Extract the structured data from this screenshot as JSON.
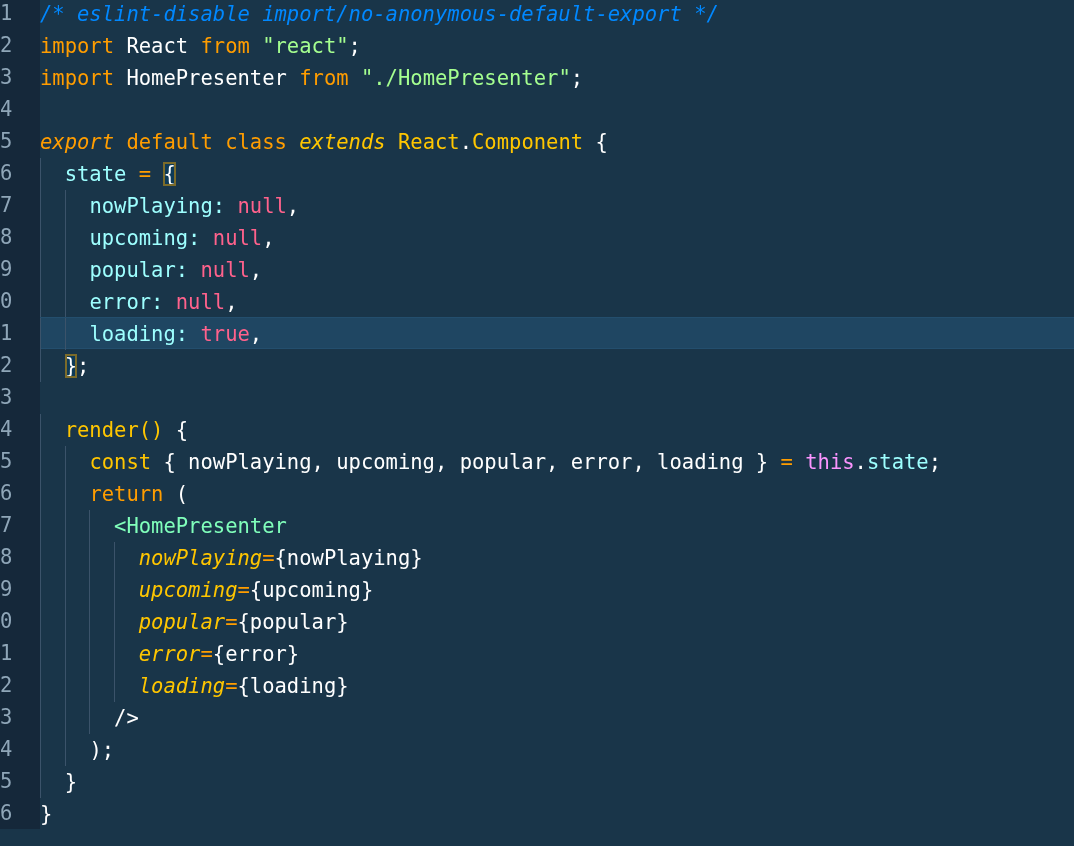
{
  "editor": {
    "lines": [
      {
        "number": "1",
        "highlighted": false,
        "tokens": [
          {
            "kind": "comment",
            "text": "/* eslint-disable import/no-anonymous-default-export */"
          }
        ]
      },
      {
        "number": "2",
        "highlighted": false,
        "tokens": [
          {
            "kind": "keyword",
            "text": "import"
          },
          {
            "kind": "plain",
            "text": " React "
          },
          {
            "kind": "keyword",
            "text": "from "
          },
          {
            "kind": "string",
            "text": "\"react\""
          },
          {
            "kind": "plain",
            "text": ";"
          }
        ]
      },
      {
        "number": "3",
        "highlighted": false,
        "tokens": [
          {
            "kind": "keyword",
            "text": "import"
          },
          {
            "kind": "plain",
            "text": " HomePresenter "
          },
          {
            "kind": "keyword",
            "text": "from "
          },
          {
            "kind": "string",
            "text": "\"./HomePresenter\""
          },
          {
            "kind": "plain",
            "text": ";"
          }
        ]
      },
      {
        "number": "4",
        "highlighted": false
      },
      {
        "number": "5",
        "highlighted": false,
        "tokens": [
          {
            "kind": "modifier",
            "text": "export "
          },
          {
            "kind": "keyword",
            "text": "default class "
          },
          {
            "kind": "extends",
            "text": "extends "
          },
          {
            "kind": "class",
            "text": "React"
          },
          {
            "kind": "plain",
            "text": "."
          },
          {
            "kind": "class",
            "text": "Component"
          },
          {
            "kind": "plain",
            "text": " {"
          }
        ]
      },
      {
        "number": "6",
        "highlighted": false,
        "tokens": [
          {
            "kind": "property",
            "text": "  state "
          },
          {
            "kind": "operator",
            "text": "= "
          },
          {
            "kind": "match",
            "text": "{"
          }
        ]
      },
      {
        "number": "7",
        "highlighted": false,
        "tokens": [
          {
            "kind": "property",
            "text": "    nowPlaying: "
          },
          {
            "kind": "constant",
            "text": "null"
          },
          {
            "kind": "plain",
            "text": ","
          }
        ]
      },
      {
        "number": "8",
        "highlighted": false,
        "tokens": [
          {
            "kind": "property",
            "text": "    upcoming: "
          },
          {
            "kind": "constant",
            "text": "null"
          },
          {
            "kind": "plain",
            "text": ","
          }
        ]
      },
      {
        "number": "9",
        "highlighted": false,
        "tokens": [
          {
            "kind": "property",
            "text": "    popular: "
          },
          {
            "kind": "constant",
            "text": "null"
          },
          {
            "kind": "plain",
            "text": ","
          }
        ]
      },
      {
        "number": "0",
        "highlighted": false,
        "tokens": [
          {
            "kind": "property",
            "text": "    error: "
          },
          {
            "kind": "constant",
            "text": "null"
          },
          {
            "kind": "plain",
            "text": ","
          }
        ]
      },
      {
        "number": "1",
        "highlighted": true,
        "tokens": [
          {
            "kind": "property",
            "text": "    loading: "
          },
          {
            "kind": "constant",
            "text": "true"
          },
          {
            "kind": "plain",
            "text": ","
          }
        ]
      },
      {
        "number": "2",
        "highlighted": false,
        "tokens": [
          {
            "kind": "match",
            "text": "  }"
          },
          {
            "kind": "plain",
            "text": ";"
          }
        ]
      },
      {
        "number": "3",
        "highlighted": false
      },
      {
        "number": "4",
        "highlighted": false,
        "tokens": [
          {
            "kind": "function",
            "text": "  render()"
          },
          {
            "kind": "plain",
            "text": " {"
          }
        ]
      },
      {
        "number": "5",
        "highlighted": false,
        "tokens": [
          {
            "kind": "storage",
            "text": "    const"
          },
          {
            "kind": "plain",
            "text": " { nowPlaying, upcoming, popular, error, loading } "
          },
          {
            "kind": "operator",
            "text": "= "
          },
          {
            "kind": "this",
            "text": "this"
          },
          {
            "kind": "plain",
            "text": "."
          },
          {
            "kind": "property",
            "text": "state"
          },
          {
            "kind": "plain",
            "text": ";"
          }
        ]
      },
      {
        "number": "6",
        "highlighted": false,
        "tokens": [
          {
            "kind": "keyword",
            "text": "    return"
          },
          {
            "kind": "plain",
            "text": " ("
          }
        ]
      },
      {
        "number": "7",
        "highlighted": false,
        "tokens": [
          {
            "kind": "tag",
            "text": "      <HomePresenter"
          }
        ]
      },
      {
        "number": "8",
        "highlighted": false,
        "tokens": [
          {
            "kind": "attribute",
            "text": "        nowPlaying"
          },
          {
            "kind": "operator",
            "text": "="
          },
          {
            "kind": "plain",
            "text": "{nowPlaying}"
          }
        ]
      },
      {
        "number": "9",
        "highlighted": false,
        "tokens": [
          {
            "kind": "attribute",
            "text": "        upcoming"
          },
          {
            "kind": "operator",
            "text": "="
          },
          {
            "kind": "plain",
            "text": "{upcoming}"
          }
        ]
      },
      {
        "number": "0",
        "highlighted": false,
        "tokens": [
          {
            "kind": "attribute",
            "text": "        popular"
          },
          {
            "kind": "operator",
            "text": "="
          },
          {
            "kind": "plain",
            "text": "{popular}"
          }
        ]
      },
      {
        "number": "1",
        "highlighted": false,
        "tokens": [
          {
            "kind": "attribute",
            "text": "        error"
          },
          {
            "kind": "operator",
            "text": "="
          },
          {
            "kind": "plain",
            "text": "{error}"
          }
        ]
      },
      {
        "number": "2",
        "highlighted": false,
        "tokens": [
          {
            "kind": "attribute",
            "text": "        loading"
          },
          {
            "kind": "operator",
            "text": "="
          },
          {
            "kind": "plain",
            "text": "{loading}"
          }
        ]
      },
      {
        "number": "3",
        "highlighted": false,
        "tokens": [
          {
            "kind": "plain",
            "text": "      />"
          }
        ]
      },
      {
        "number": "4",
        "highlighted": false,
        "tokens": [
          {
            "kind": "plain",
            "text": "    );"
          }
        ]
      },
      {
        "number": "5",
        "highlighted": false,
        "tokens": [
          {
            "kind": "plain",
            "text": "  }"
          }
        ]
      },
      {
        "number": "6",
        "highlighted": false,
        "tokens": [
          {
            "kind": "plain",
            "text": "}"
          }
        ]
      }
    ]
  }
}
